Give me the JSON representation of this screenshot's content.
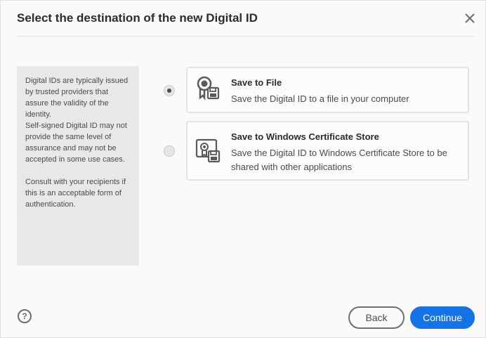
{
  "dialog": {
    "title": "Select the destination of the new Digital ID",
    "close_icon": "close-icon"
  },
  "info_panel": {
    "paragraph1": "Digital IDs are typically issued by trusted providers that assure the validity of the identity.",
    "paragraph2": "Self-signed Digital ID may not provide the same level of assurance and may not be accepted in some use cases.",
    "paragraph3": "Consult with your recipients if this is an acceptable form of authentication."
  },
  "options": [
    {
      "title": "Save to File",
      "description": "Save the Digital ID to a file in your computer",
      "icon": "certificate-file-icon",
      "selected": true
    },
    {
      "title": "Save to Windows Certificate Store",
      "description": "Save the Digital ID to Windows Certificate Store to be shared with other applications",
      "icon": "certificate-store-icon",
      "selected": false
    }
  ],
  "footer": {
    "help_label": "?",
    "back_label": "Back",
    "continue_label": "Continue"
  },
  "colors": {
    "accent": "#1473e6",
    "panel": "#e8e8e8",
    "background": "#fafafa"
  }
}
